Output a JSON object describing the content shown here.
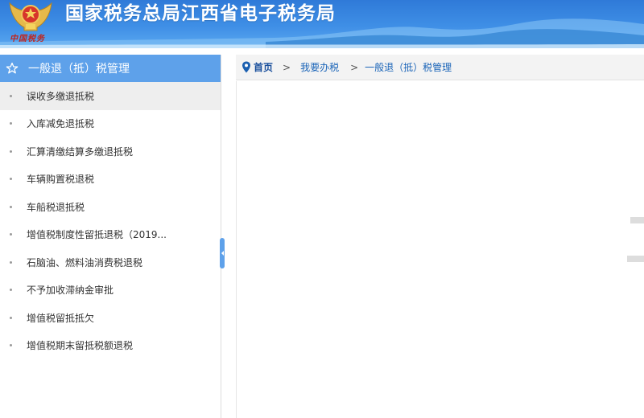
{
  "header": {
    "title": "国家税务总局江西省电子税务局",
    "emblem_caption": "中国税务",
    "colors": {
      "top": "#2f7ad8",
      "bottom": "#5aa8f0"
    }
  },
  "sidebar": {
    "title": "一般退（抵）税管理",
    "icon": "star-outline-icon",
    "items": [
      {
        "label": "误收多缴退抵税",
        "active": true
      },
      {
        "label": "入库减免退抵税",
        "active": false
      },
      {
        "label": "汇算清缴结算多缴退抵税",
        "active": false
      },
      {
        "label": "车辆购置税退税",
        "active": false
      },
      {
        "label": "车船税退抵税",
        "active": false
      },
      {
        "label": "增值税制度性留抵退税（2019...",
        "active": false
      },
      {
        "label": "石脑油、燃料油消费税退税",
        "active": false
      },
      {
        "label": "不予加收滞纳金审批",
        "active": false
      },
      {
        "label": "增值税留抵抵欠",
        "active": false
      },
      {
        "label": "增值税期末留抵税额退税",
        "active": false
      }
    ]
  },
  "breadcrumb": {
    "home": "首页",
    "separator": ">",
    "items": [
      "我要办税",
      "一般退（抵）税管理"
    ],
    "icon": "location-pin-icon"
  },
  "theme": {
    "accent": "#5ea1ea",
    "link": "#1a64b8",
    "active_row": "#eeeeee"
  }
}
